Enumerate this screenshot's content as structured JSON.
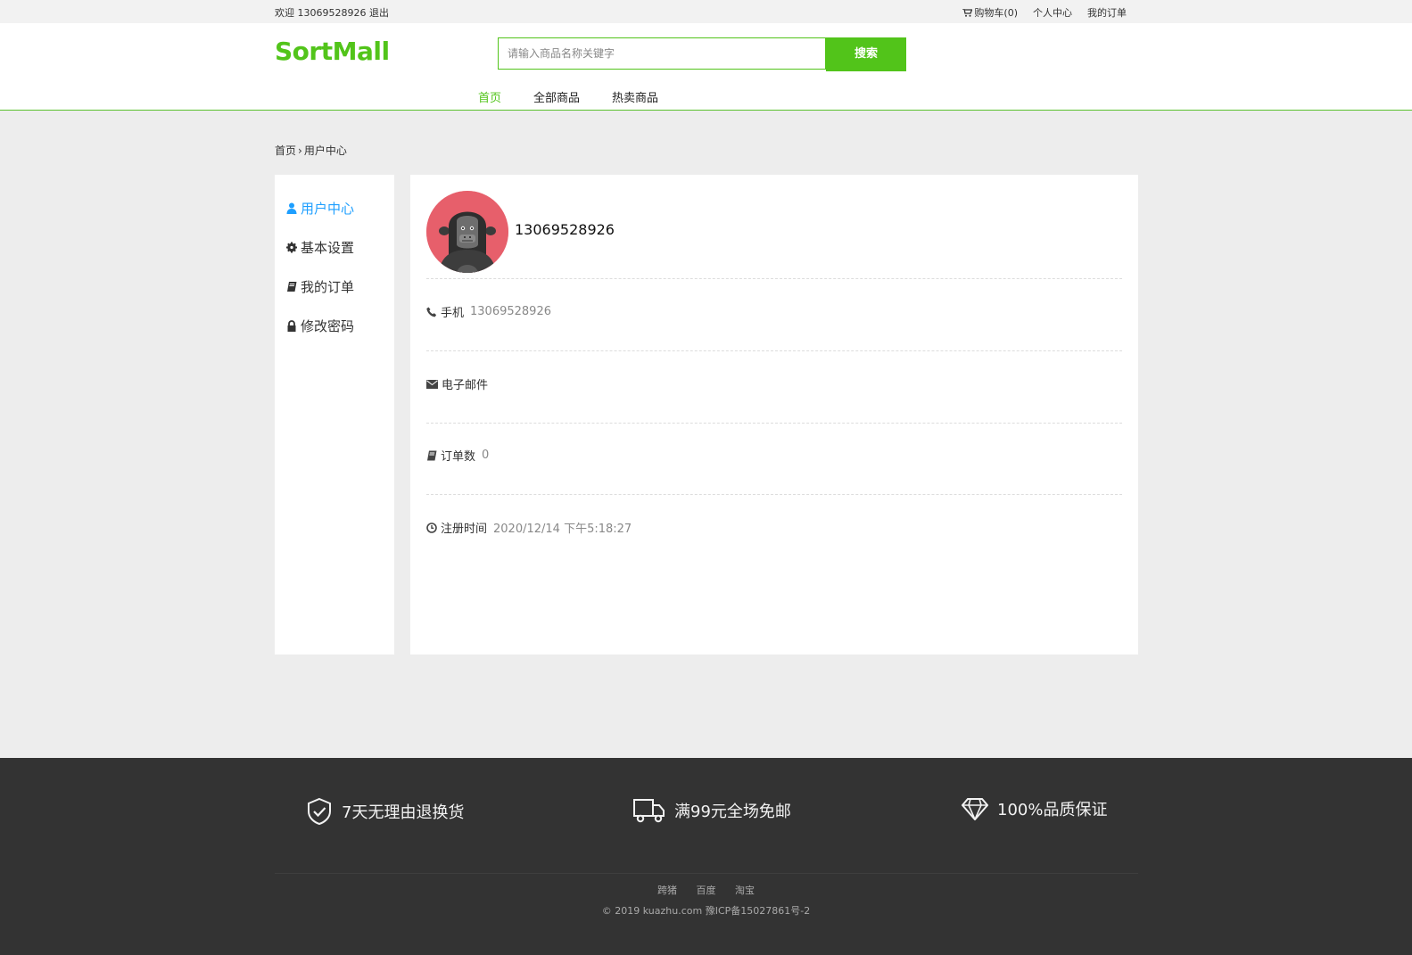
{
  "topbar": {
    "welcome": "欢迎 13069528926",
    "logout": "退出",
    "cart": "购物车(0)",
    "personal_center": "个人中心",
    "my_orders": "我的订单"
  },
  "header": {
    "logo": "SortMall",
    "search_placeholder": "请输入商品名称关键字",
    "search_button": "搜索",
    "nav": [
      "首页",
      "全部商品",
      "热卖商品"
    ],
    "active_nav_index": 0
  },
  "breadcrumb": {
    "home": "首页",
    "separator": "›",
    "current": "用户中心"
  },
  "sidebar": {
    "items": [
      {
        "label": "用户中心",
        "icon": "user-icon",
        "active": true
      },
      {
        "label": "基本设置",
        "icon": "gear-icon",
        "active": false
      },
      {
        "label": "我的订单",
        "icon": "book-icon",
        "active": false
      },
      {
        "label": "修改密码",
        "icon": "lock-icon",
        "active": false
      }
    ]
  },
  "profile": {
    "username": "13069528926",
    "phone_label": "手机",
    "phone_value": "13069528926",
    "email_label": "电子邮件",
    "email_value": "",
    "orders_label": "订单数",
    "orders_value": "0",
    "register_label": "注册时间",
    "register_value": "2020/12/14 下午5:18:27"
  },
  "footer": {
    "promises": [
      {
        "text": "7天无理由退换货",
        "icon": "shield-check-icon"
      },
      {
        "text": "满99元全场免邮",
        "icon": "truck-icon"
      },
      {
        "text": "100%品质保证",
        "icon": "diamond-icon"
      }
    ],
    "links": [
      "跨猪",
      "百度",
      "淘宝"
    ],
    "copyright": "© 2019 kuazhu.com 豫ICP备15027861号-2"
  },
  "colors": {
    "brand_green": "#52c41a",
    "active_blue": "#1e9fff",
    "footer_bg": "#333333"
  }
}
